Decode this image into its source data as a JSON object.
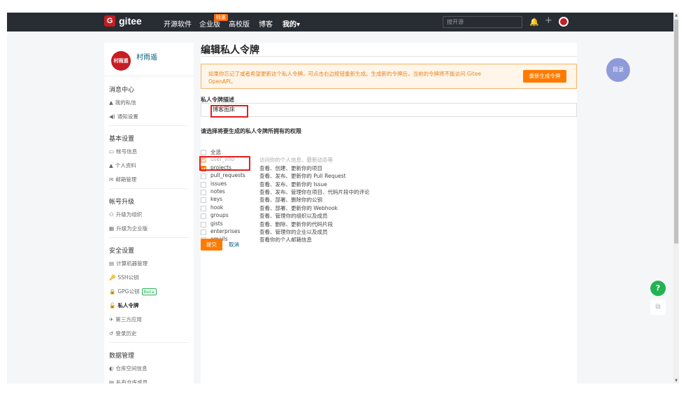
{
  "navbar": {
    "logo_mark": "G",
    "logo_text": "gitee",
    "links": [
      "开源软件",
      "企业版",
      "高校版",
      "博客",
      "我的"
    ],
    "enterprise_badge": "特惠",
    "my_chevron": "▾",
    "search_placeholder": "搜开源",
    "bell_icon": "🔔",
    "plus_icon": "+"
  },
  "sidebar": {
    "user_name": "村雨遥",
    "avatar_text": "村雨遥",
    "sections": [
      {
        "title": "消息中心",
        "items": [
          {
            "icon": "▲",
            "label": "我的私信"
          },
          {
            "icon": "◀)",
            "label": "通知设置"
          }
        ]
      },
      {
        "title": "基本设置",
        "items": [
          {
            "icon": "▭",
            "label": "帐号信息"
          },
          {
            "icon": "▲",
            "label": "个人资料"
          },
          {
            "icon": "✉",
            "label": "邮箱管理"
          }
        ]
      },
      {
        "title": "帐号升级",
        "items": [
          {
            "icon": "⚇",
            "label": "升级为组织"
          },
          {
            "icon": "▦",
            "label": "升级为企业版"
          }
        ]
      },
      {
        "title": "安全设置",
        "items": [
          {
            "icon": "▤",
            "label": "计算机器管理"
          },
          {
            "icon": "🔑",
            "label": "SSH公钥"
          },
          {
            "icon": "🔒",
            "label": "GPG公钥",
            "badge": "Beta"
          },
          {
            "icon": "🔓",
            "label": "私人令牌",
            "active": true
          },
          {
            "icon": "✈",
            "label": "第三方应用"
          },
          {
            "icon": "↺",
            "label": "登录历史"
          }
        ]
      },
      {
        "title": "数据管理",
        "items": [
          {
            "icon": "◐",
            "label": "仓库空间信息"
          },
          {
            "icon": "▤",
            "label": "私有仓库成员"
          }
        ]
      }
    ]
  },
  "main": {
    "title": "编辑私人令牌",
    "notice": "如果你忘记了或者希望更新这个私人令牌，可点击右边按钮重新生成。生成新的令牌后，当前的令牌将不能访问 Gitee OpenAPI。",
    "regen_button": "重新生成令牌",
    "desc_label": "私人令牌描述",
    "desc_value": "博客图床",
    "perm_label": "请选择将要生成的私人令牌所拥有的权限",
    "permissions": [
      {
        "name": "全选",
        "desc": "",
        "state": "unchecked"
      },
      {
        "name": "user_info",
        "desc": "访问你的个人信息、最新动态等",
        "state": "disabled"
      },
      {
        "name": "projects",
        "desc": "查看、创建、更新你的项目",
        "state": "checked"
      },
      {
        "name": "pull_requests",
        "desc": "查看、发布、更新你的 Pull Request",
        "state": "unchecked"
      },
      {
        "name": "issues",
        "desc": "查看、发布、更新你的 Issue",
        "state": "unchecked"
      },
      {
        "name": "notes",
        "desc": "查看、发布、管理你在项目、代码片段中的评论",
        "state": "unchecked"
      },
      {
        "name": "keys",
        "desc": "查看、部署、删除你的公钥",
        "state": "unchecked"
      },
      {
        "name": "hook",
        "desc": "查看、部署、更新你的 Webhook",
        "state": "unchecked"
      },
      {
        "name": "groups",
        "desc": "查看、管理你的组织以及成员",
        "state": "unchecked"
      },
      {
        "name": "gists",
        "desc": "查看、删除、更新你的代码片段",
        "state": "unchecked"
      },
      {
        "name": "enterprises",
        "desc": "查看、管理你的企业以及成员",
        "state": "unchecked"
      },
      {
        "name": "emails",
        "desc": "查看你的个人邮箱信息",
        "state": "unchecked"
      }
    ],
    "submit": "提交",
    "cancel": "取消"
  },
  "floating": {
    "toc": "目录",
    "help": "?",
    "external_icon": "⧉"
  }
}
